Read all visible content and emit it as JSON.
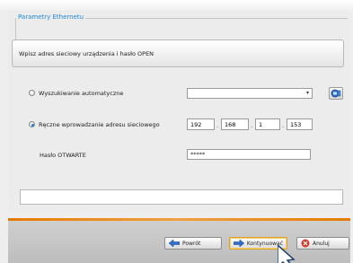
{
  "dialog": {
    "group_title": "Parametry Ethernetu",
    "instruction": "Wpisz adres sieciowy urządzenia i hasło OPEN"
  },
  "options": {
    "auto_label": "Wyszukiwanie automatyczne",
    "auto_selected": false,
    "auto_select_value": "",
    "manual_label": "Ręczne wprowadzanie adresu sieciowego",
    "manual_selected": true
  },
  "ip": {
    "octet1": "192",
    "octet2": "168",
    "octet3": "1",
    "octet4": "153",
    "separator": "."
  },
  "password": {
    "label": "Hasło OTWARTE",
    "value": "*****"
  },
  "status_text": "",
  "buttons": {
    "back": "Powrót",
    "continue": "Kontynuować",
    "cancel": "Anuluj"
  },
  "colors": {
    "accent": "#1e88d8",
    "separator": "#e67a00",
    "back_icon": "#2f6fd0",
    "cancel_icon": "#d23b2b"
  },
  "icons": {
    "refresh": "network-search-icon",
    "back": "arrow-left-icon",
    "continue": "arrow-right-icon",
    "cancel": "cancel-icon"
  }
}
